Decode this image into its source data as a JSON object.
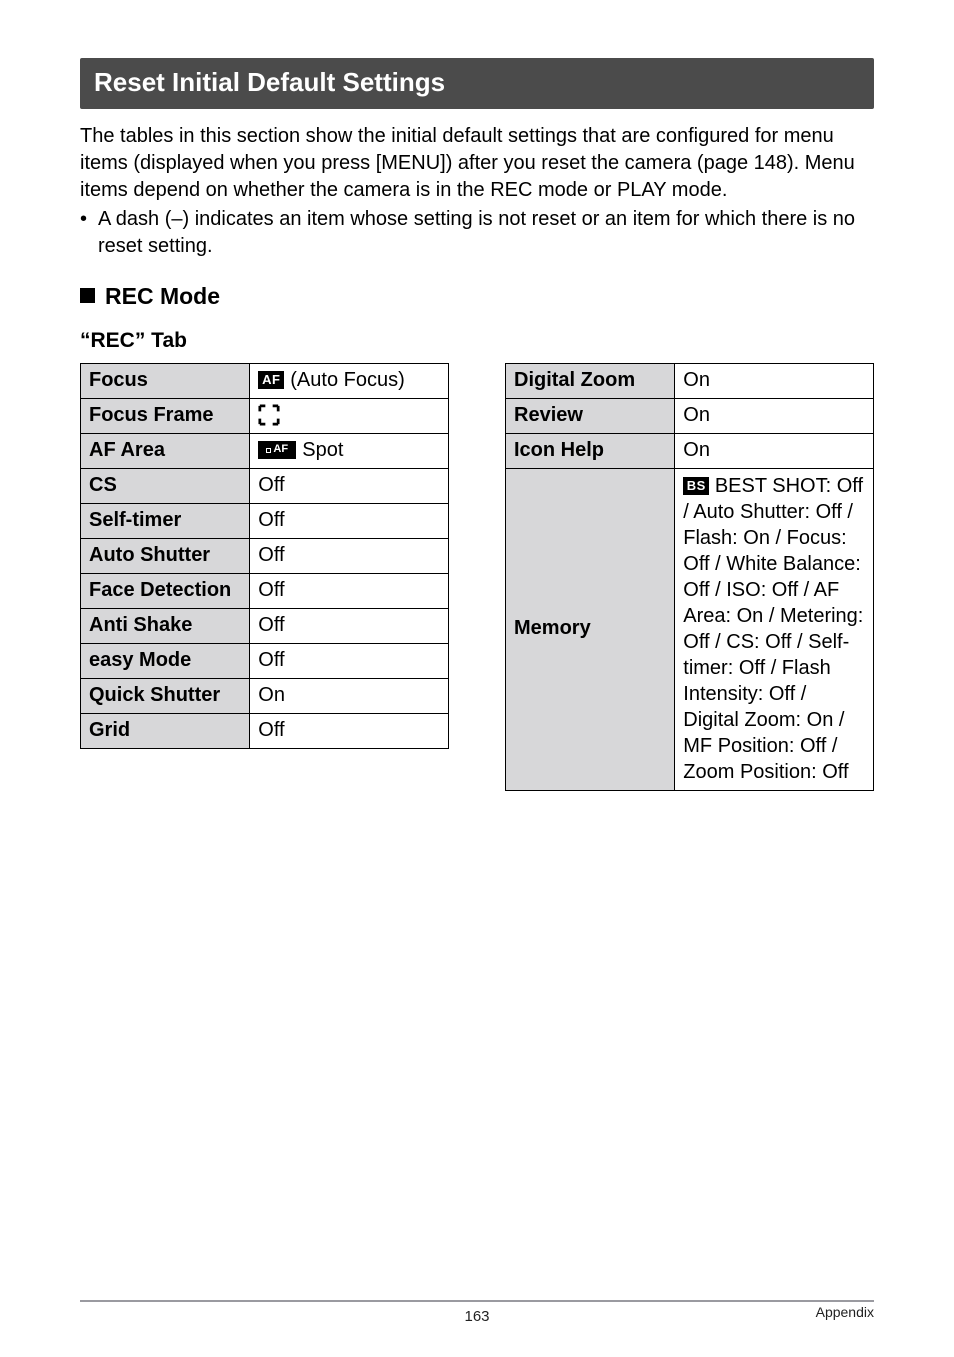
{
  "section_title": "Reset Initial Default Settings",
  "intro_lines": [
    "The tables in this section show the initial default settings that are configured for menu items (displayed when you press [MENU]) after you reset the camera (page 148). Menu items depend on whether the camera is in the REC mode or PLAY mode."
  ],
  "bullet_text": "A dash (–) indicates an item whose setting is not reset or an item for which there is no reset setting.",
  "rec_mode_heading": "REC Mode",
  "rec_tab_heading": "“REC” Tab",
  "left_table": [
    {
      "label": "Focus",
      "icon": "af",
      "value": "(Auto Focus)"
    },
    {
      "label": "Focus Frame",
      "icon": "frame",
      "value": ""
    },
    {
      "label": "AF Area",
      "icon": "spot",
      "value": "Spot"
    },
    {
      "label": "CS",
      "icon": "",
      "value": "Off"
    },
    {
      "label": "Self-timer",
      "icon": "",
      "value": "Off"
    },
    {
      "label": "Auto Shutter",
      "icon": "",
      "value": "Off"
    },
    {
      "label": "Face Detection",
      "icon": "",
      "value": "Off"
    },
    {
      "label": "Anti Shake",
      "icon": "",
      "value": "Off"
    },
    {
      "label": "easy Mode",
      "icon": "",
      "value": "Off"
    },
    {
      "label": "Quick Shutter",
      "icon": "",
      "value": "On"
    },
    {
      "label": "Grid",
      "icon": "",
      "value": "Off"
    }
  ],
  "right_table": [
    {
      "label": "Digital Zoom",
      "icon": "",
      "value": "On"
    },
    {
      "label": "Review",
      "icon": "",
      "value": "On"
    },
    {
      "label": "Icon Help",
      "icon": "",
      "value": "On"
    },
    {
      "label": "Memory",
      "icon": "bs",
      "value": "BEST SHOT: Off / Auto Shutter: Off / Flash: On / Focus: Off / White Balance: Off / ISO: Off / AF Area: On / Metering: Off / CS: Off / Self-timer: Off / Flash Intensity: Off / Digital Zoom: On / MF Position: Off / Zoom Position: Off"
    }
  ],
  "icons": {
    "af_text": "AF",
    "spot_text": "AF",
    "bs_text": "BS"
  },
  "footer": {
    "page_number": "163",
    "appendix": "Appendix"
  }
}
